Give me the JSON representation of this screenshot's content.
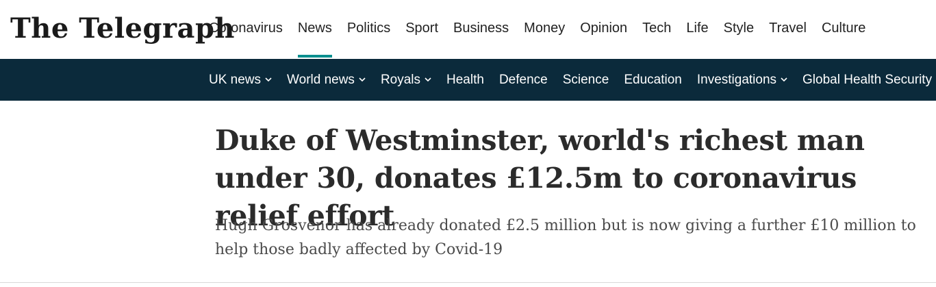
{
  "logo": {
    "text": "The Telegraph"
  },
  "primary_nav": {
    "items": [
      {
        "label": "Coronavirus"
      },
      {
        "label": "News",
        "active": true
      },
      {
        "label": "Politics"
      },
      {
        "label": "Sport"
      },
      {
        "label": "Business"
      },
      {
        "label": "Money"
      },
      {
        "label": "Opinion"
      },
      {
        "label": "Tech"
      },
      {
        "label": "Life"
      },
      {
        "label": "Style"
      },
      {
        "label": "Travel"
      },
      {
        "label": "Culture"
      }
    ],
    "active_indicator_color": "#0a8f8f"
  },
  "secondary_nav": {
    "background_color": "#0b2a3b",
    "items": [
      {
        "label": "UK news",
        "has_dropdown": true
      },
      {
        "label": "World news",
        "has_dropdown": true
      },
      {
        "label": "Royals",
        "has_dropdown": true
      },
      {
        "label": "Health",
        "has_dropdown": false
      },
      {
        "label": "Defence",
        "has_dropdown": false
      },
      {
        "label": "Science",
        "has_dropdown": false
      },
      {
        "label": "Education",
        "has_dropdown": false
      },
      {
        "label": "Investigations",
        "has_dropdown": true
      },
      {
        "label": "Global Health Security",
        "has_dropdown": false
      }
    ],
    "dropdown_icon": "chevron-down-icon"
  },
  "article": {
    "headline": "Duke of Westminster, world's richest man under 30, donates £12.5m to coronavirus relief effort",
    "standfirst": "Hugh Grosvenor has already donated £2.5 million but is now giving a further £10 million to help those badly affected by Covid-19"
  }
}
